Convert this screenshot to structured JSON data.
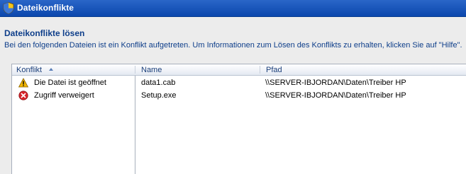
{
  "window": {
    "title": "Dateikonflikte",
    "title_icon": "security-shield-icon"
  },
  "heading": "Dateikonflikte lösen",
  "description": "Bei den folgenden Dateien ist ein Konflikt aufgetreten. Um Informationen zum Lösen des Konflikts zu erhalten, klicken Sie auf \"Hilfe\".",
  "columns": {
    "conflict": "Konflikt",
    "name": "Name",
    "path": "Pfad"
  },
  "sort": {
    "column": "conflict",
    "direction": "ascending"
  },
  "rows": [
    {
      "conflict": "Die Datei ist geöffnet",
      "icon": "warning-icon",
      "name": "data1.cab",
      "path": "\\\\SERVER-IBJORDAN\\Daten\\Treiber HP"
    },
    {
      "conflict": "Zugriff verweigert",
      "icon": "error-icon",
      "name": "Setup.exe",
      "path": "\\\\SERVER-IBJORDAN\\Daten\\Treiber HP"
    }
  ],
  "colors": {
    "titlebar": "#0b47ad",
    "heading": "#0e3e8a",
    "warning": "#f2b600",
    "error": "#d8232a"
  }
}
